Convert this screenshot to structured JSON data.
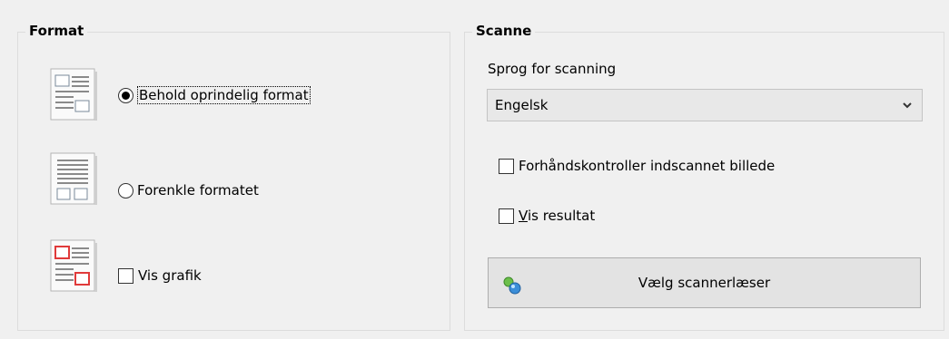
{
  "format": {
    "legend": "Format",
    "keep_format_label": "Behold oprindelig format",
    "simplify_label": "Forenkle formatet",
    "show_graphics_label": "Vis grafik",
    "keep_format_selected": true
  },
  "scan": {
    "legend": "Scanne",
    "language_label": "Sprog for scanning",
    "language_value": "Engelsk",
    "preview_label": "Forhåndskontroller indscannet billede",
    "show_result_first": "V",
    "show_result_rest": "is resultat",
    "choose_scanner_label": "Vælg scannerlæser"
  },
  "icons": [
    "format-keep-icon",
    "format-simplify-icon",
    "format-graphics-icon",
    "scanner-icon",
    "chevron-down-icon"
  ]
}
